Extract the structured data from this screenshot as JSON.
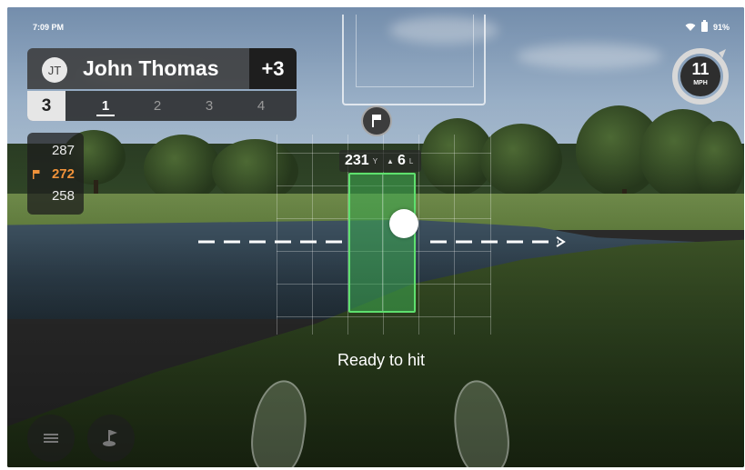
{
  "status_bar": {
    "time": "7:09 PM",
    "battery": "91%",
    "icons": [
      "wifi-icon",
      "battery-icon"
    ]
  },
  "player": {
    "initials": "JT",
    "name": "John Thomas",
    "score": "+3",
    "current_hole": "3",
    "shots": [
      "1",
      "2",
      "3",
      "4"
    ],
    "active_shot": "1"
  },
  "distances": {
    "back": "287",
    "pin": "272",
    "front": "258"
  },
  "wind": {
    "speed": "11",
    "unit": "MPH"
  },
  "aim": {
    "distance": "231",
    "distance_unit": "Y",
    "offset": "6",
    "offset_unit": "L"
  },
  "status_message": "Ready to hit",
  "buttons": {
    "menu": "menu-icon",
    "course": "golf-flag-icon"
  },
  "colors": {
    "target_green": "#5ee06e",
    "pin_orange": "#f0923a"
  }
}
